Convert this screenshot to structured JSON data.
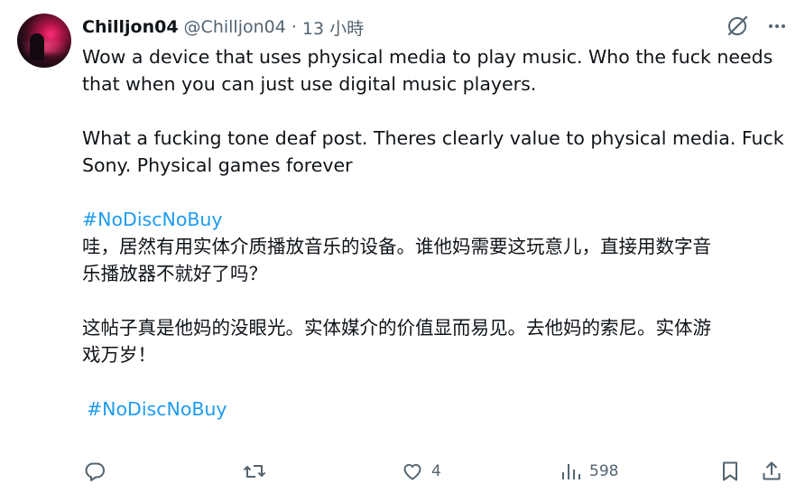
{
  "tweet": {
    "author_name": "Chilljon04",
    "author_handle": "@Chilljon04",
    "separator": "·",
    "time": "13 小時",
    "paragraph1_line1": "Wow a device that uses physical media to play music. Who the fuck needs",
    "paragraph1_line2": "that when you can just use digital music players.",
    "paragraph2_line1": "What a fucking tone deaf post. Theres clearly value to physical media. Fuck",
    "paragraph2_line2": "Sony. Physical games forever",
    "hashtag_en": "#NoDiscNoBuy",
    "cn_paragraph1_line1": "哇，居然有用实体介质播放音乐的设备。谁他妈需要这玩意儿，直接用数字音",
    "cn_paragraph1_line2": "乐播放器不就好了吗？",
    "cn_paragraph2_line1": "这帖子真是他妈的没眼光。实体媒介的价值显而易见。去他妈的索尼。实体游",
    "cn_paragraph2_line2": "戏万岁！",
    "hashtag_cn": "#NoDiscNoBuy"
  },
  "actions": {
    "likes": "4",
    "views": "598"
  },
  "icons": [
    "grok-icon",
    "more-icon",
    "reply-icon",
    "retweet-icon",
    "like-icon",
    "views-icon",
    "bookmark-icon",
    "share-icon"
  ],
  "colors": {
    "text": "#0f1419",
    "secondary": "#536471",
    "link": "#1d9bf0"
  }
}
